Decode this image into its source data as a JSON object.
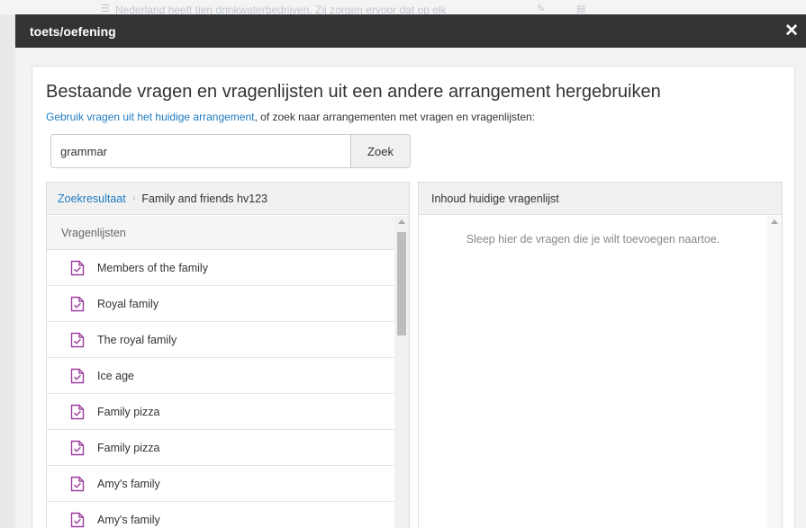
{
  "background": {
    "text": "Nederland heeft tien drinkwaterbedrijven. Zij zorgen ervoor dat op elk"
  },
  "modal": {
    "title": "toets/oefening",
    "close_symbol": "✕"
  },
  "main": {
    "heading": "Bestaande vragen en vragenlijsten uit een andere arrangement hergebruiken",
    "link_text": "Gebruik vragen uit het huidige arrangement",
    "subline_rest": ", of zoek naar arrangementen met vragen en vragenlijsten:"
  },
  "search": {
    "value": "grammar",
    "button_label": "Zoek"
  },
  "results": {
    "breadcrumb_link": "Zoekresultaat",
    "breadcrumb_separator": "›",
    "breadcrumb_current": "Family and friends hv123",
    "section_label": "Vragenlijsten",
    "items": [
      {
        "label": "Members of the family",
        "icon": "questionnaire-doc-icon"
      },
      {
        "label": "Royal family",
        "icon": "questionnaire-doc-icon"
      },
      {
        "label": "The royal family",
        "icon": "questionnaire-doc-icon"
      },
      {
        "label": "Ice age",
        "icon": "questionnaire-doc-icon"
      },
      {
        "label": "Family pizza",
        "icon": "questionnaire-doc-icon"
      },
      {
        "label": "Family pizza",
        "icon": "questionnaire-doc-icon"
      },
      {
        "label": "Amy's family",
        "icon": "questionnaire-doc-icon"
      },
      {
        "label": "Amy's family",
        "icon": "questionnaire-doc-icon"
      }
    ]
  },
  "current": {
    "header": "Inhoud huidige vragenlijst",
    "drop_hint": "Sleep hier de vragen die je wilt toevoegen naartoe."
  },
  "colors": {
    "header_bg": "#333333",
    "link": "#1f7bc1",
    "icon_accent": "#9b3f9b"
  }
}
